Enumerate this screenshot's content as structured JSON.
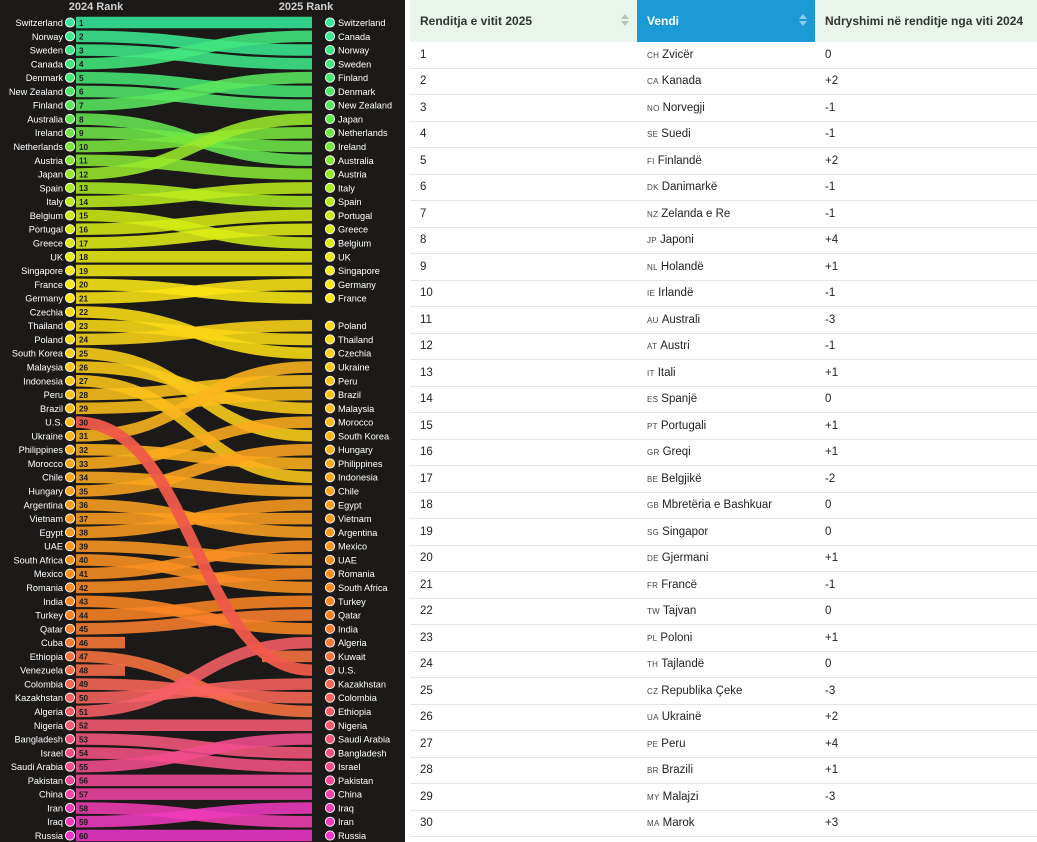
{
  "chart_data": {
    "type": "bump",
    "left_title": "2024 Rank",
    "right_title": "2025 Rank",
    "countries": [
      {
        "name": "Switzerland",
        "r2024": 1,
        "r2025": 1
      },
      {
        "name": "Norway",
        "r2024": 2,
        "r2025": 3
      },
      {
        "name": "Sweden",
        "r2024": 3,
        "r2025": 4
      },
      {
        "name": "Canada",
        "r2024": 4,
        "r2025": 2
      },
      {
        "name": "Denmark",
        "r2024": 5,
        "r2025": 6
      },
      {
        "name": "New Zealand",
        "r2024": 6,
        "r2025": 7
      },
      {
        "name": "Finland",
        "r2024": 7,
        "r2025": 5
      },
      {
        "name": "Australia",
        "r2024": 8,
        "r2025": 11
      },
      {
        "name": "Ireland",
        "r2024": 9,
        "r2025": 10
      },
      {
        "name": "Netherlands",
        "r2024": 10,
        "r2025": 9
      },
      {
        "name": "Austria",
        "r2024": 11,
        "r2025": 12
      },
      {
        "name": "Japan",
        "r2024": 12,
        "r2025": 8
      },
      {
        "name": "Spain",
        "r2024": 13,
        "r2025": 14
      },
      {
        "name": "Italy",
        "r2024": 14,
        "r2025": 13
      },
      {
        "name": "Belgium",
        "r2024": 15,
        "r2025": 17
      },
      {
        "name": "Portugal",
        "r2024": 16,
        "r2025": 15
      },
      {
        "name": "Greece",
        "r2024": 17,
        "r2025": 16
      },
      {
        "name": "UK",
        "r2024": 18,
        "r2025": 18
      },
      {
        "name": "Singapore",
        "r2024": 19,
        "r2025": 19
      },
      {
        "name": "France",
        "r2024": 20,
        "r2025": 21
      },
      {
        "name": "Germany",
        "r2024": 21,
        "r2025": 20
      },
      {
        "name": "Czechia",
        "r2024": 22,
        "r2025": 25
      },
      {
        "name": "Thailand",
        "r2024": 23,
        "r2025": 24
      },
      {
        "name": "Poland",
        "r2024": 24,
        "r2025": 23
      },
      {
        "name": "South Korea",
        "r2024": 25,
        "r2025": 31
      },
      {
        "name": "Malaysia",
        "r2024": 26,
        "r2025": 29
      },
      {
        "name": "Indonesia",
        "r2024": 27,
        "r2025": 34
      },
      {
        "name": "Peru",
        "r2024": 28,
        "r2025": 27
      },
      {
        "name": "Brazil",
        "r2024": 29,
        "r2025": 28
      },
      {
        "name": "U.S.",
        "r2024": 30,
        "r2025": 48
      },
      {
        "name": "Ukraine",
        "r2024": 31,
        "r2025": 26
      },
      {
        "name": "Philippines",
        "r2024": 32,
        "r2025": 33
      },
      {
        "name": "Morocco",
        "r2024": 33,
        "r2025": 30
      },
      {
        "name": "Chile",
        "r2024": 34,
        "r2025": 35
      },
      {
        "name": "Hungary",
        "r2024": 35,
        "r2025": 32
      },
      {
        "name": "Argentina",
        "r2024": 36,
        "r2025": 38
      },
      {
        "name": "Vietnam",
        "r2024": 37,
        "r2025": 37
      },
      {
        "name": "Egypt",
        "r2024": 38,
        "r2025": 36
      },
      {
        "name": "UAE",
        "r2024": 39,
        "r2025": 40
      },
      {
        "name": "South Africa",
        "r2024": 40,
        "r2025": 42
      },
      {
        "name": "Mexico",
        "r2024": 41,
        "r2025": 39
      },
      {
        "name": "Romania",
        "r2024": 42,
        "r2025": 41
      },
      {
        "name": "India",
        "r2024": 43,
        "r2025": 45
      },
      {
        "name": "Turkey",
        "r2024": 44,
        "r2025": 43
      },
      {
        "name": "Qatar",
        "r2024": 45,
        "r2025": 44
      },
      {
        "name": "Cuba",
        "r2024": 46,
        "r2025": null
      },
      {
        "name": "Ethiopia",
        "r2024": 47,
        "r2025": 51
      },
      {
        "name": "Venezuela",
        "r2024": 48,
        "r2025": null
      },
      {
        "name": "Colombia",
        "r2024": 49,
        "r2025": 50
      },
      {
        "name": "Kazakhstan",
        "r2024": 50,
        "r2025": 49
      },
      {
        "name": "Algeria",
        "r2024": 51,
        "r2025": 46
      },
      {
        "name": "Nigeria",
        "r2024": 52,
        "r2025": 52
      },
      {
        "name": "Bangladesh",
        "r2024": 53,
        "r2025": 54
      },
      {
        "name": "Israel",
        "r2024": 54,
        "r2025": 55
      },
      {
        "name": "Saudi Arabia",
        "r2024": 55,
        "r2025": 53
      },
      {
        "name": "Pakistan",
        "r2024": 56,
        "r2025": 56
      },
      {
        "name": "China",
        "r2024": 57,
        "r2025": 57
      },
      {
        "name": "Iran",
        "r2024": 58,
        "r2025": 59
      },
      {
        "name": "Iraq",
        "r2024": 59,
        "r2025": 58
      },
      {
        "name": "Russia",
        "r2024": 60,
        "r2025": 60
      },
      {
        "name": "Kuwait",
        "r2024": null,
        "r2025": 47
      }
    ]
  },
  "table": {
    "headers": [
      "Renditja e vitit 2025",
      "Vendi",
      "Ndryshimi në renditje nga viti 2024"
    ],
    "rows": [
      {
        "rank": "1",
        "code": "CH",
        "country": "Zvicër",
        "change": "0"
      },
      {
        "rank": "2",
        "code": "CA",
        "country": "Kanada",
        "change": "+2"
      },
      {
        "rank": "3",
        "code": "NO",
        "country": "Norvegji",
        "change": "-1"
      },
      {
        "rank": "4",
        "code": "SE",
        "country": "Suedi",
        "change": "-1"
      },
      {
        "rank": "5",
        "code": "FI",
        "country": "Finlandë",
        "change": "+2"
      },
      {
        "rank": "6",
        "code": "DK",
        "country": "Danimarkë",
        "change": "-1"
      },
      {
        "rank": "7",
        "code": "NZ",
        "country": "Zelanda e Re",
        "change": "-1"
      },
      {
        "rank": "8",
        "code": "JP",
        "country": "Japoni",
        "change": "+4"
      },
      {
        "rank": "9",
        "code": "NL",
        "country": "Holandë",
        "change": "+1"
      },
      {
        "rank": "10",
        "code": "IE",
        "country": "Irlandë",
        "change": "-1"
      },
      {
        "rank": "11",
        "code": "AU",
        "country": "Australi",
        "change": "-3"
      },
      {
        "rank": "12",
        "code": "AT",
        "country": "Austri",
        "change": "-1"
      },
      {
        "rank": "13",
        "code": "IT",
        "country": "Itali",
        "change": "+1"
      },
      {
        "rank": "14",
        "code": "ES",
        "country": "Spanjë",
        "change": "0"
      },
      {
        "rank": "15",
        "code": "PT",
        "country": "Portugali",
        "change": "+1"
      },
      {
        "rank": "16",
        "code": "GR",
        "country": "Greqi",
        "change": "+1"
      },
      {
        "rank": "17",
        "code": "BE",
        "country": "Belgjikë",
        "change": "-2"
      },
      {
        "rank": "18",
        "code": "GB",
        "country": "Mbretëria e Bashkuar",
        "change": "0"
      },
      {
        "rank": "19",
        "code": "SG",
        "country": "Singapor",
        "change": "0"
      },
      {
        "rank": "20",
        "code": "DE",
        "country": "Gjermani",
        "change": "+1"
      },
      {
        "rank": "21",
        "code": "FR",
        "country": "Francë",
        "change": "-1"
      },
      {
        "rank": "22",
        "code": "TW",
        "country": "Tajvan",
        "change": "0"
      },
      {
        "rank": "23",
        "code": "PL",
        "country": "Poloni",
        "change": "+1"
      },
      {
        "rank": "24",
        "code": "TH",
        "country": "Tajlandë",
        "change": "0"
      },
      {
        "rank": "25",
        "code": "CZ",
        "country": "Republika Çeke",
        "change": "-3"
      },
      {
        "rank": "26",
        "code": "UA",
        "country": "Ukrainë",
        "change": "+2"
      },
      {
        "rank": "27",
        "code": "PE",
        "country": "Peru",
        "change": "+4"
      },
      {
        "rank": "28",
        "code": "BR",
        "country": "Brazili",
        "change": "+1"
      },
      {
        "rank": "29",
        "code": "MY",
        "country": "Malajzi",
        "change": "-3"
      },
      {
        "rank": "30",
        "code": "MA",
        "country": "Marok",
        "change": "+3"
      }
    ]
  },
  "colors": {
    "chart_background": "#1c1a18",
    "header_blue": "#1b9ad6",
    "header_green": "#e9f5ea",
    "us_highlight": "#ef5a4a"
  }
}
